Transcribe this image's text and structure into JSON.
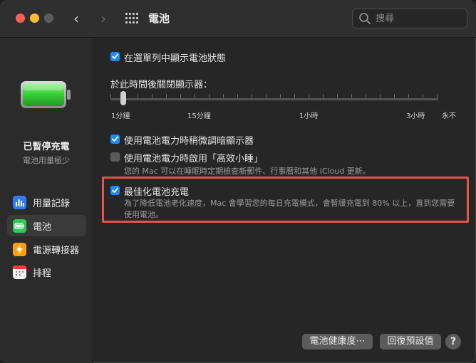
{
  "window": {
    "title": "電池",
    "back_glyph": "‹",
    "forward_glyph": "›"
  },
  "search": {
    "placeholder": "搜尋"
  },
  "sidebar": {
    "status_title": "已暫停充電",
    "status_subtitle": "電池用量極少",
    "items": [
      {
        "label": "用量記錄",
        "icon": "chart-bars-icon",
        "color": "#2f7cf6"
      },
      {
        "label": "電池",
        "icon": "battery-icon",
        "color": "#34c759",
        "selected": true
      },
      {
        "label": "電源轉接器",
        "icon": "bolt-icon",
        "color": "#ff9f0a"
      },
      {
        "label": "排程",
        "icon": "calendar-icon",
        "color": "#f2f2f2"
      }
    ]
  },
  "main": {
    "show_status_label": "在選單列中顯示電池狀態",
    "show_status_checked": true,
    "display_off_label": "於此時間後關閉顯示器：",
    "slider": {
      "labels": [
        "1分鐘",
        "15分鐘",
        "1小時",
        "3小時",
        "永不"
      ],
      "value": "1分鐘"
    },
    "dim_label": "使用電池電力時稍微調暗顯示器",
    "dim_checked": true,
    "power_nap_label": "使用電池電力時啟用「高效小睡」",
    "power_nap_checked": false,
    "power_nap_note": "您的 Mac 可以在睡眠時定期檢查新郵件、行事曆和其他 iCloud 更新。",
    "optimize_label": "最佳化電池充電",
    "optimize_checked": true,
    "optimize_note": "為了降低電池老化速度，Mac 會學習您的每日充電模式，會暫緩充電到 80% 以上，直到您需要使用電池。"
  },
  "footer": {
    "health_button": "電池健康度⋯",
    "restore_button": "回復預設值",
    "help_button": "?"
  },
  "colors": {
    "accent": "#1e88ff",
    "highlight": "#e5544b",
    "battery_green": "#34c759"
  }
}
